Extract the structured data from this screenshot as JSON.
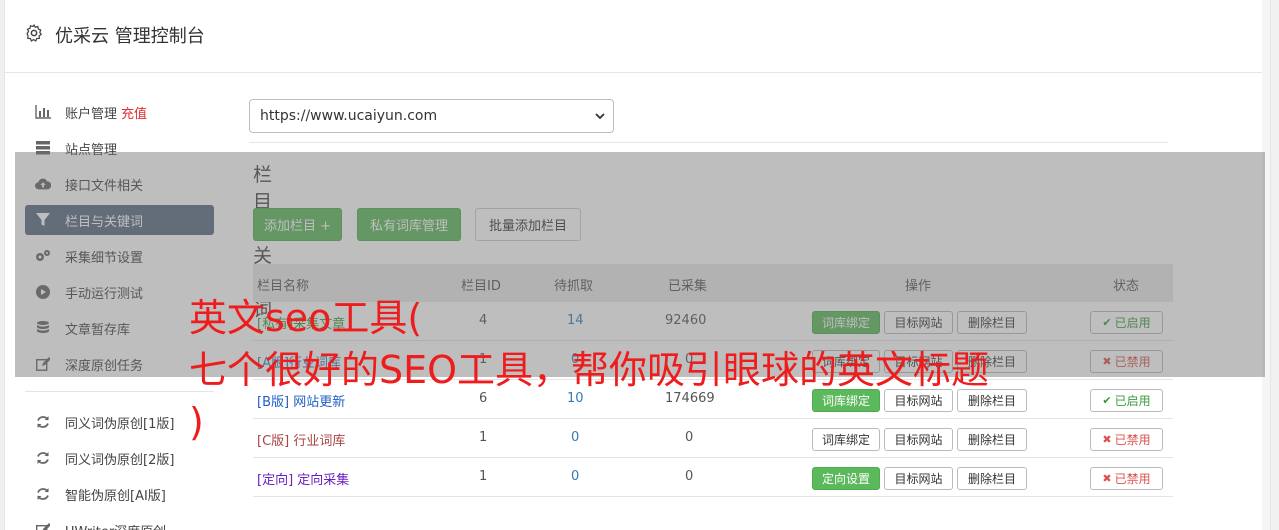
{
  "header": {
    "title": "优采云 管理控制台",
    "icon": "gear-icon"
  },
  "sidebar": {
    "items": [
      {
        "label": "账户管理",
        "extra": "充值",
        "icon": "bar-chart-icon"
      },
      {
        "label": "站点管理",
        "icon": "server-icon"
      },
      {
        "label": "接口文件相关",
        "icon": "cloud-upload-icon"
      },
      {
        "label": "栏目与关键词",
        "icon": "filter-icon",
        "active": true
      },
      {
        "label": "采集细节设置",
        "icon": "cogs-icon"
      },
      {
        "label": "手动运行测试",
        "icon": "play-circle-icon"
      },
      {
        "label": "文章暂存库",
        "icon": "database-icon"
      },
      {
        "label": "深度原创任务",
        "icon": "edit-icon"
      },
      {
        "label": "同义词伪原创[1版]",
        "icon": "refresh-icon"
      },
      {
        "label": "同义词伪原创[2版]",
        "icon": "refresh-icon"
      },
      {
        "label": "智能伪原创[AI版]",
        "icon": "refresh-icon"
      },
      {
        "label": "UWriter深度原创",
        "icon": "edit-icon"
      }
    ]
  },
  "main": {
    "site_select": {
      "value": "https://www.ucaiyun.com"
    },
    "section_title": "栏目与关键词",
    "buttons": {
      "add_column": "添加栏目 +",
      "private_lib": "私有词库管理",
      "batch_add": "批量添加栏目"
    },
    "table": {
      "headers": {
        "name": "栏目名称",
        "id": "栏目ID",
        "pending": "待抓取",
        "collected": "已采集",
        "ops": "操作",
        "status": "状态"
      },
      "rows": [
        {
          "name": "[私有]采集文章",
          "name_color": "#3c9a3c",
          "id": "4",
          "pending": "14",
          "collected": "92460",
          "op1": "词库绑定",
          "op1_green": true,
          "op2": "目标网站",
          "op3": "删除栏目",
          "status": "已启用",
          "status_on": true
        },
        {
          "name": "[A版]行业词库",
          "name_color": "#337ab7",
          "id": "1",
          "pending": "0",
          "collected": "0",
          "op1": "词库绑定",
          "op1_green": false,
          "op2": "目标网站",
          "op3": "删除栏目",
          "status": "已禁用",
          "status_on": false
        },
        {
          "name": "[B版] 网站更新",
          "name_color": "#1f5fc6",
          "id": "6",
          "pending": "10",
          "collected": "174669",
          "op1": "词库绑定",
          "op1_green": true,
          "op2": "目标网站",
          "op3": "删除栏目",
          "status": "已启用",
          "status_on": true
        },
        {
          "name": "[C版] 行业词库",
          "name_color": "#a94442",
          "id": "1",
          "pending": "0",
          "collected": "0",
          "op1": "词库绑定",
          "op1_green": false,
          "op2": "目标网站",
          "op3": "删除栏目",
          "status": "已禁用",
          "status_on": false
        },
        {
          "name": "[定向] 定向采集",
          "name_color": "#6a1fbf",
          "id": "1",
          "pending": "0",
          "collected": "0",
          "op1": "定向设置",
          "op1_green": true,
          "op2": "目标网站",
          "op3": "删除栏目",
          "status": "已禁用",
          "status_on": false
        }
      ]
    }
  },
  "watermark": {
    "line1": "英文seo工具(",
    "line2": "七个很好的SEO工具，帮你吸引眼球的英文标题",
    "line3": ")"
  },
  "colors": {
    "accent_green": "#5cb85c",
    "sidebar_active": "#5a6c82",
    "watermark_red": "#ee1c1c",
    "recharge_red": "#e32b2b"
  }
}
